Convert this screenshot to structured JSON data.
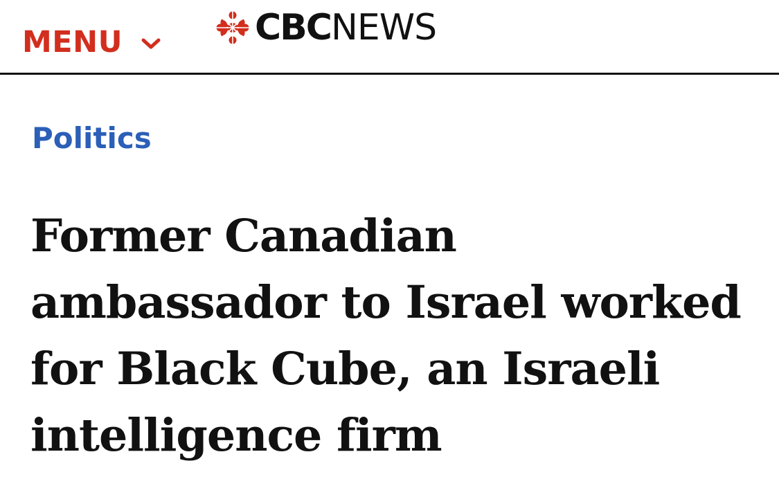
{
  "header": {
    "menu_label": "MENU",
    "menu_icon": "chevron-down-icon",
    "logo": {
      "icon": "cbc-gem-icon",
      "brand": "CBC",
      "suffix": "NEWS"
    }
  },
  "article": {
    "section": "Politics",
    "headline": "Former Canadian ambassador to Israel worked for Black Cube, an Israeli intelligence firm"
  },
  "colors": {
    "menu": "#d22e1e",
    "gem": "#d22e1e",
    "section_link": "#2b5fb8",
    "text": "#111111",
    "divider": "#111111",
    "background": "#ffffff"
  }
}
